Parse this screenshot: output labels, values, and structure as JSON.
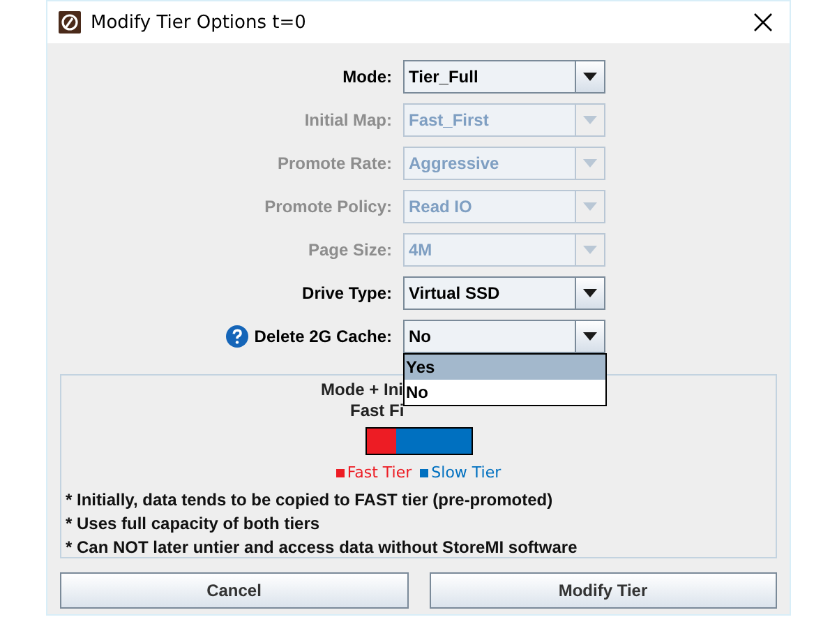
{
  "window": {
    "title": "Modify Tier Options t=0"
  },
  "form": {
    "fields": [
      {
        "label": "Mode:",
        "value": "Tier_Full",
        "disabled": false,
        "help": false,
        "expanded": false
      },
      {
        "label": "Initial Map:",
        "value": "Fast_First",
        "disabled": true,
        "help": false,
        "expanded": false
      },
      {
        "label": "Promote Rate:",
        "value": "Aggressive",
        "disabled": true,
        "help": false,
        "expanded": false
      },
      {
        "label": "Promote Policy:",
        "value": "Read IO",
        "disabled": true,
        "help": false,
        "expanded": false
      },
      {
        "label": "Page Size:",
        "value": "4M",
        "disabled": true,
        "help": false,
        "expanded": false
      },
      {
        "label": "Drive Type:",
        "value": "Virtual SSD",
        "disabled": false,
        "help": false,
        "expanded": false
      },
      {
        "label": "Delete 2G Cache:",
        "value": "No",
        "disabled": false,
        "help": true,
        "expanded": true
      }
    ]
  },
  "dropdown": {
    "options": [
      {
        "label": "Yes",
        "selected": true
      },
      {
        "label": "No",
        "selected": false
      }
    ]
  },
  "info_panel": {
    "title": "Mode + Ini",
    "subtitle": "Fast Fi",
    "bar": {
      "level": 0.28
    },
    "legend": [
      {
        "label": "Fast Tier",
        "color": "#ed1c24"
      },
      {
        "label": "Slow Tier",
        "color": "#0070c0"
      }
    ],
    "notes": [
      "* Initially, data tends to be copied to FAST tier (pre-promoted)",
      "* Uses full capacity of both tiers",
      "* Can NOT later untier and access data without StoreMI software"
    ]
  },
  "buttons": [
    "Cancel",
    "Modify Tier"
  ]
}
